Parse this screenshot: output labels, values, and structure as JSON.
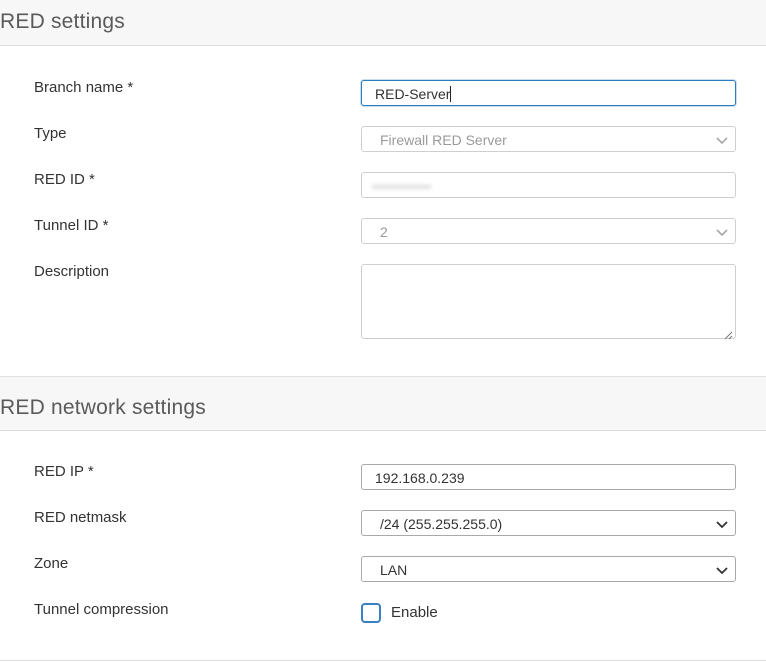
{
  "red_settings": {
    "title": "RED settings",
    "branch_name": {
      "label": "Branch name *",
      "value": "RED-Server"
    },
    "type": {
      "label": "Type",
      "value": "Firewall RED Server"
    },
    "red_id": {
      "label": "RED ID *",
      "value": "•••••••••••••"
    },
    "tunnel_id": {
      "label": "Tunnel ID *",
      "value": "2"
    },
    "description": {
      "label": "Description",
      "value": ""
    }
  },
  "red_network_settings": {
    "title": "RED network settings",
    "red_ip": {
      "label": "RED IP *",
      "value": "192.168.0.239"
    },
    "red_netmask": {
      "label": "RED netmask",
      "value": "/24 (255.255.255.0)"
    },
    "zone": {
      "label": "Zone",
      "value": "LAN"
    },
    "tunnel_compression": {
      "label": "Tunnel compression",
      "checkbox_label": "Enable",
      "checked": false
    }
  },
  "colors": {
    "accent": "#2a7bbf",
    "header_bg": "#f7f7f7",
    "disabled_text": "#9a9a9a"
  },
  "icons": {
    "dropdown": "chevron-down-icon",
    "resize": "resize-grip-icon"
  }
}
